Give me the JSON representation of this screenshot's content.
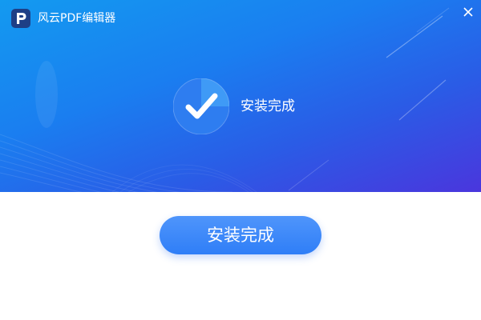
{
  "window": {
    "title": "风云PDF编辑器",
    "logo_icon": "pdf-editor-logo-icon",
    "close_icon": "close-icon"
  },
  "status": {
    "icon": "checkmark-icon",
    "text": "安装完成"
  },
  "actions": {
    "finish_label": "安装完成"
  },
  "colors": {
    "banner_start": "#139af0",
    "banner_end": "#4a36dd",
    "button": "#3a88f9",
    "text_on_blue": "#ffffff"
  }
}
